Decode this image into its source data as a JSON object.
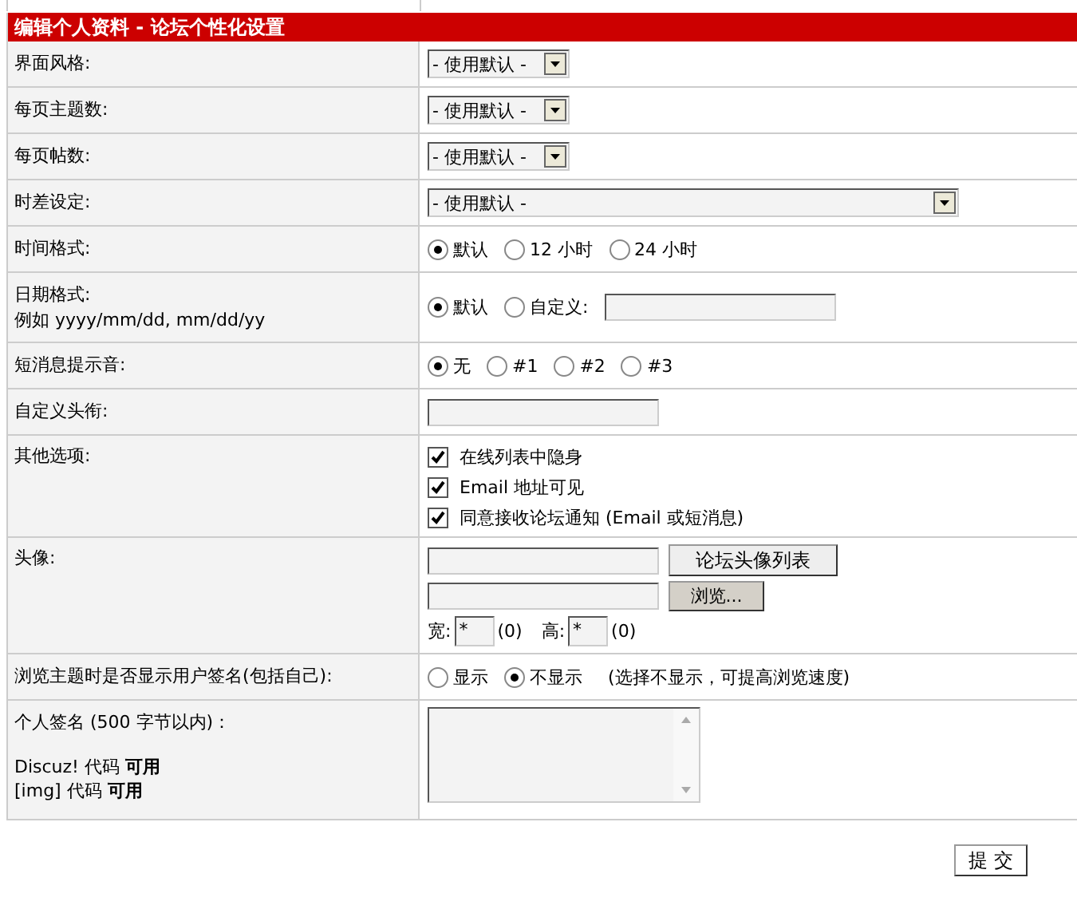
{
  "header": {
    "title": "编辑个人资料 - 论坛个性化设置"
  },
  "rows": [
    {
      "label": "界面风格:",
      "kind": "select",
      "value": "- 使用默认 -",
      "wide": false
    },
    {
      "label": "每页主题数:",
      "kind": "select",
      "value": "- 使用默认 -",
      "wide": false
    },
    {
      "label": "每页帖数:",
      "kind": "select",
      "value": "- 使用默认 -",
      "wide": false
    },
    {
      "label": "时差设定:",
      "kind": "select",
      "value": "- 使用默认 -",
      "wide": true
    },
    {
      "label": "时间格式:",
      "kind": "radio",
      "options": [
        {
          "label": "默认",
          "selected": true
        },
        {
          "label": "12 小时",
          "selected": false
        },
        {
          "label": "24 小时",
          "selected": false
        }
      ]
    },
    {
      "label": "日期格式:",
      "hint": "例如  yyyy/mm/dd, mm/dd/yy",
      "kind": "radio",
      "with_input": true,
      "options": [
        {
          "label": "默认",
          "selected": true
        },
        {
          "label": "自定义:",
          "selected": false
        }
      ]
    },
    {
      "label": "短消息提示音:",
      "kind": "radio",
      "options": [
        {
          "label": "无",
          "selected": true
        },
        {
          "label": "#1",
          "selected": false
        },
        {
          "label": "#2",
          "selected": false
        },
        {
          "label": "#3",
          "selected": false
        }
      ]
    },
    {
      "label": "自定义头衔:",
      "kind": "text"
    },
    {
      "label": "其他选项:",
      "kind": "checkbox",
      "options": [
        {
          "label": "在线列表中隐身",
          "checked": true
        },
        {
          "label": "Email 地址可见",
          "checked": true
        },
        {
          "label": "同意接收论坛通知 (Email 或短消息)",
          "checked": true
        }
      ]
    },
    {
      "label": "头像:",
      "kind": "avatar",
      "list_button": "论坛头像列表",
      "browse_button": "浏览...",
      "width_label": "宽:",
      "width_value": "*",
      "width_note": "(0)",
      "height_label": "高:",
      "height_value": "*",
      "height_note": "(0)"
    },
    {
      "label": "浏览主题时是否显示用户签名(包括自己):",
      "kind": "radio",
      "note": "(选择不显示，可提高浏览速度)",
      "options": [
        {
          "label": "显示",
          "selected": false
        },
        {
          "label": "不显示",
          "selected": true
        }
      ]
    },
    {
      "label": "个人签名 (500 字节以内)：",
      "notes": [
        "Discuz! 代码  **可用**",
        "[img] 代码  **可用**"
      ],
      "kind": "textarea"
    }
  ],
  "submit": "提 交"
}
